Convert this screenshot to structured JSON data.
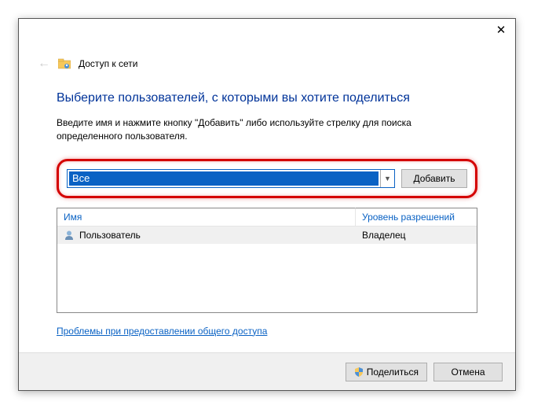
{
  "breadcrumb": {
    "title": "Доступ к сети"
  },
  "heading": "Выберите пользователей, с которыми вы хотите поделиться",
  "instruction": "Введите имя и нажмите кнопку \"Добавить\" либо используйте стрелку для поиска определенного пользователя.",
  "combo": {
    "value": "Все"
  },
  "buttons": {
    "add": "Добавить",
    "share": "Поделиться",
    "cancel": "Отмена"
  },
  "table": {
    "col_name": "Имя",
    "col_perm": "Уровень разрешений",
    "rows": [
      {
        "name": "Пользователь",
        "perm": "Владелец"
      }
    ]
  },
  "help_link": "Проблемы при предоставлении общего доступа"
}
